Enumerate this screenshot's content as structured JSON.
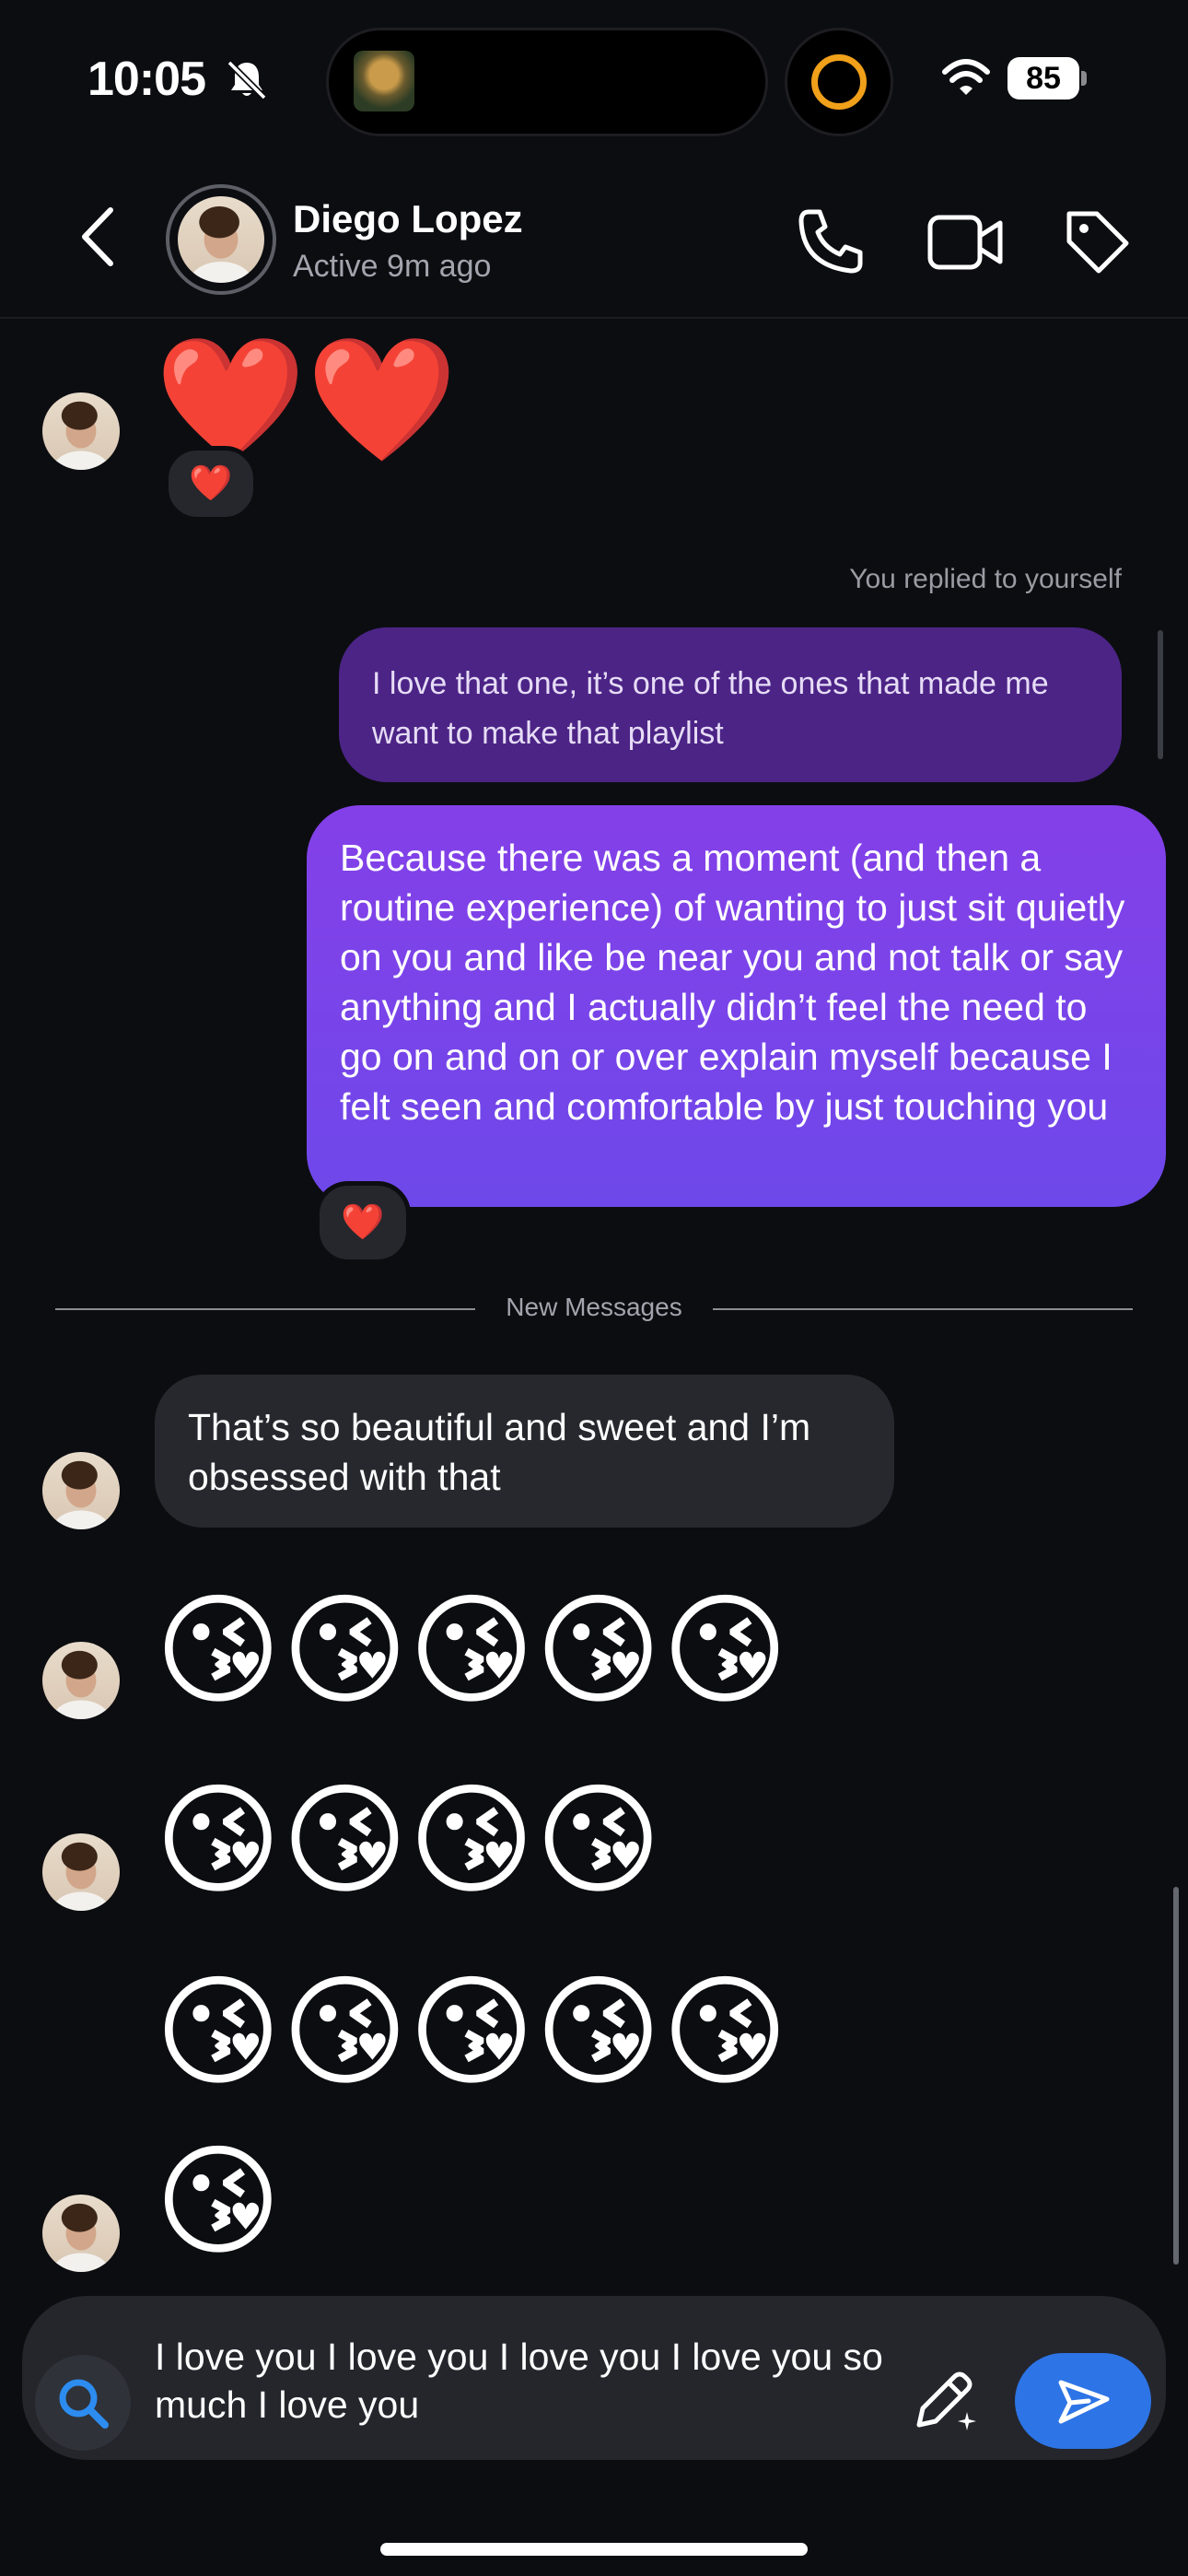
{
  "status_bar": {
    "time": "10:05",
    "battery": "85"
  },
  "header": {
    "name": "Diego Lopez",
    "status": "Active 9m ago"
  },
  "messages": {
    "hearts": "❤️❤️",
    "hearts_reaction": "❤️",
    "reply_label": "You replied to yourself",
    "reply_text": "I love that one, it’s one of the ones that made me want to make that playlist",
    "long_text": "Because there was a moment (and then a routine experience) of wanting to just sit quietly on you and like be near you and not talk or say anything and I actually didn’t feel the need to go on and on or over explain myself because I felt seen and comfortable by just touching you",
    "long_reaction": "❤️",
    "divider": "New Messages",
    "incoming_text": "That’s so beautiful and sweet and I’m obsessed with that",
    "kiss_row_1": "😘😘😘😘😘",
    "kiss_row_2": "😘😘😘😘",
    "kiss_row_3": "😘😘😘😘😘",
    "kiss_row_4": "😘"
  },
  "composer": {
    "text": "I love you I love you I love you I love you so much I love you"
  },
  "colors": {
    "accent": "#2d74e6",
    "outgoing_bubble": "#7a44e9",
    "background": "#0c0d11"
  }
}
